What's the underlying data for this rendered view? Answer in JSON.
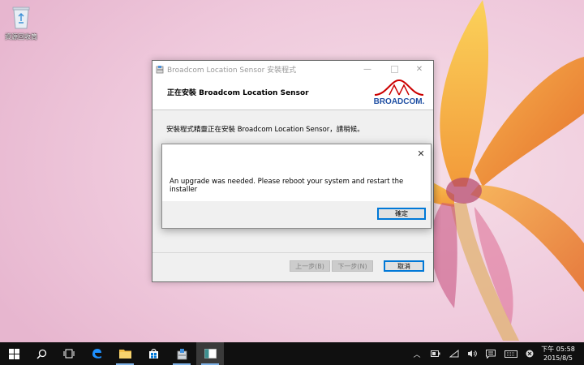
{
  "desktop": {
    "recycle_bin_label": "資源回收筒",
    "icons": [
      "recycle-bin-icon"
    ]
  },
  "installer": {
    "window_title": "Broadcom Location Sensor 安裝程式",
    "header_title": "正在安裝 Broadcom Location Sensor",
    "logo_text": "BROADCOM.",
    "progress_text": "安裝程式精靈正在安裝 Broadcom Location Sensor，請稍候。",
    "back_label": "上一步(B)",
    "next_label": "下一步(N)",
    "cancel_label": "取消",
    "back_enabled": false,
    "next_enabled": false
  },
  "modal": {
    "message": "An upgrade was needed. Please reboot your system and restart the installer",
    "ok_label": "確定"
  },
  "taskbar": {
    "apps": [
      "start-icon",
      "search-icon",
      "task-view-icon",
      "edge-icon",
      "file-explorer-icon",
      "store-icon",
      "installer-app-icon",
      "dialog-app-icon"
    ],
    "clock_time": "下午 05:58",
    "clock_date": "2015/8/5"
  },
  "colors": {
    "taskbar": "#101010",
    "accent": "#0078d7",
    "logo_red": "#cc0000",
    "logo_blue": "#1f4fa3"
  }
}
